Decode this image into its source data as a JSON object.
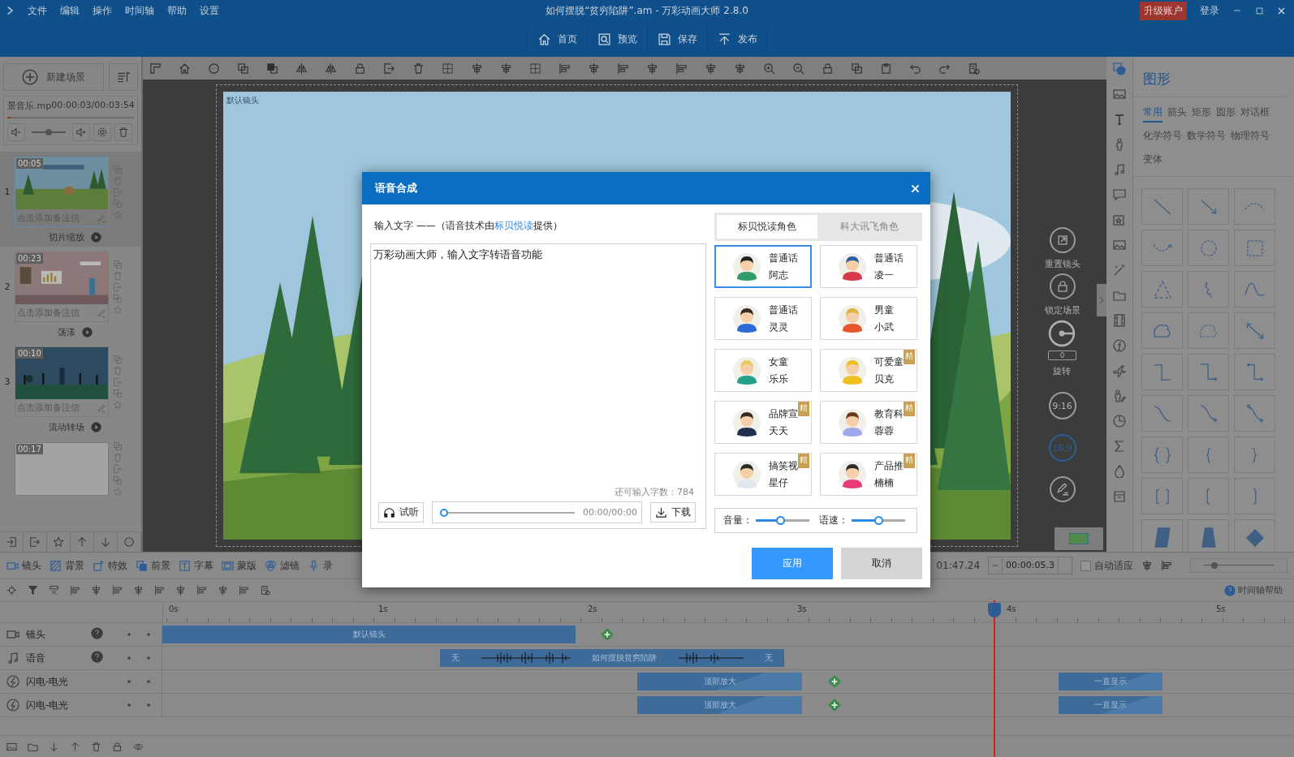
{
  "window": {
    "title": "如何摆脱“贫穷陷阱”.am - 万彩动画大师 2.8.0"
  },
  "menu": [
    "文件",
    "编辑",
    "操作",
    "时间轴",
    "帮助",
    "设置"
  ],
  "account": {
    "upgrade": "升级账户",
    "login": "登录"
  },
  "quick_actions": [
    {
      "label": "首页",
      "kind": "home"
    },
    {
      "label": "预览",
      "kind": "preview"
    },
    {
      "label": "保存",
      "kind": "save"
    },
    {
      "label": "发布",
      "kind": "publish"
    }
  ],
  "scene_panel": {
    "new_scene": "新建场景",
    "audio": {
      "file": "景音乐.mp",
      "time": "00:00:03/00:03:54",
      "level": 0.03,
      "volume": {
        "level": 0.5
      }
    },
    "scenes": [
      {
        "number": "1",
        "duration": "00:05",
        "note": "点击添加备注信",
        "transition": "切片缩放",
        "selected": true,
        "kind": "forest"
      },
      {
        "number": "2",
        "duration": "00:23",
        "note": "点击添加备注信",
        "transition": "荡漾",
        "selected": false,
        "kind": "office"
      },
      {
        "number": "3",
        "duration": "00:10",
        "note": "点击添加备注信",
        "transition": "流动转场",
        "selected": false,
        "kind": "night"
      },
      {
        "duration": "00:17",
        "selected": false,
        "kind": "blank"
      }
    ]
  },
  "stage": {
    "camera_label": "默认镜头",
    "controls": [
      {
        "label": "重置镜头",
        "kind": "reset"
      },
      {
        "label": "锁定场景",
        "kind": "lock"
      }
    ],
    "rotation": {
      "value": "0",
      "label": "旋转"
    },
    "aspect_ratios": [
      {
        "label": "9:16",
        "selected": false
      },
      {
        "label": "16:9",
        "selected": true
      }
    ]
  },
  "shape_panel": {
    "title": "图形",
    "tabs": [
      {
        "label": "常用",
        "selected": true
      },
      {
        "label": "箭头",
        "selected": false
      },
      {
        "label": "矩形",
        "selected": false
      },
      {
        "label": "圆形",
        "selected": false
      },
      {
        "label": "对话框",
        "selected": false
      },
      {
        "label": "化学符号",
        "selected": false
      },
      {
        "label": "数学符号",
        "selected": false
      },
      {
        "label": "物理符号",
        "selected": false
      },
      {
        "label": "变体",
        "selected": false
      }
    ]
  },
  "timeline": {
    "tools": [
      {
        "label": "镜头",
        "kind": "camera"
      },
      {
        "label": "背景",
        "kind": "bg"
      },
      {
        "label": "特效",
        "kind": "fx"
      },
      {
        "label": "前景",
        "kind": "fg"
      },
      {
        "label": "字幕",
        "kind": "caption"
      },
      {
        "label": "蒙版",
        "kind": "mask"
      },
      {
        "label": "滤镜",
        "kind": "filter"
      },
      {
        "label": "录",
        "kind": "mic"
      }
    ],
    "time": "01:47.24",
    "zoom_value": "00:00:05.3",
    "auto_fit": {
      "label": "自动适应",
      "checked": false
    },
    "zoom_slider": {
      "level": 0.15
    },
    "help": "时间轴帮助",
    "ruler": [
      "0s",
      "1s",
      "2s",
      "3s",
      "4s",
      "5s"
    ],
    "tracks": [
      {
        "name": "镜头",
        "kind": "camera",
        "help": true,
        "clips": [
          {
            "label": "默认镜头"
          }
        ]
      },
      {
        "name": "语音",
        "kind": "audio",
        "help": true,
        "clips": [
          {
            "label": "如何摆脱贫穷陷阱",
            "start_label": "无",
            "end_label": "无"
          }
        ]
      },
      {
        "name": "闪电-电光",
        "kind": "effect",
        "help": false,
        "clips": [
          {
            "label": "顶部放大"
          },
          {
            "label": "一直显示"
          }
        ]
      },
      {
        "name": "闪电-电光",
        "kind": "effect",
        "help": false,
        "clips": [
          {
            "label": "顶部放大"
          },
          {
            "label": "一直显示"
          }
        ]
      }
    ]
  },
  "dialog": {
    "title": "语音合成",
    "input_label": {
      "prefix": "输入文字 ——（语音技术由",
      "link": "标贝悦读",
      "suffix": "提供）"
    },
    "text": "万彩动画大师，输入文字转语音功能",
    "remaining": "还可输入字数：784",
    "preview": "试听",
    "playback": {
      "level": 0,
      "time": "00:00/00:00"
    },
    "download": "下载",
    "voice_tabs": [
      {
        "label": "标贝悦读角色",
        "selected": true
      },
      {
        "label": "科大讯飞角色",
        "selected": false
      }
    ],
    "voices": [
      {
        "line1": "普通话",
        "line2": "阿志",
        "selected": true
      },
      {
        "line1": "普通话",
        "line2": "凌一",
        "selected": false
      },
      {
        "line1": "普通话",
        "line2": "灵灵",
        "selected": false
      },
      {
        "line1": "男童",
        "line2": "小武",
        "selected": false
      },
      {
        "line1": "女童",
        "line2": "乐乐",
        "selected": false
      },
      {
        "line1": "可爱童",
        "line2": "贝克",
        "selected": false,
        "badge": "精"
      },
      {
        "line1": "品牌宣",
        "line2": "天天",
        "selected": false,
        "badge": "精"
      },
      {
        "line1": "教育科",
        "line2": "蓉蓉",
        "selected": false,
        "badge": "精"
      },
      {
        "line1": "搞笑视",
        "line2": "星仔",
        "selected": false,
        "badge": "精"
      },
      {
        "line1": "产品推",
        "line2": "楠楠",
        "selected": false,
        "badge": "精"
      }
    ],
    "sliders": [
      {
        "label": "音量：",
        "level": 0.45
      },
      {
        "label": "语速：",
        "level": 0.5
      }
    ],
    "buttons": [
      {
        "label": "应用",
        "kind": "primary"
      },
      {
        "label": "取消",
        "kind": "secondary"
      }
    ]
  }
}
